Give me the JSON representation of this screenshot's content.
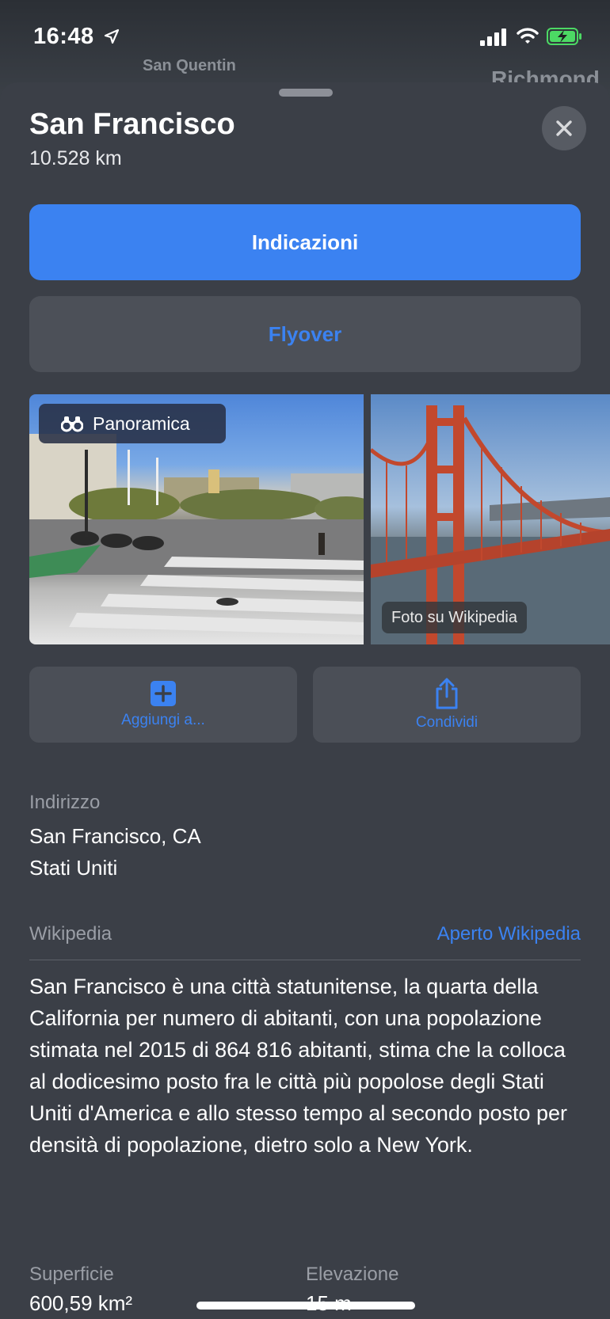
{
  "status_bar": {
    "time": "16:48"
  },
  "map": {
    "labels": [
      "San Quentin",
      "Richmond"
    ]
  },
  "place": {
    "title": "San Francisco",
    "distance": "10.528 km"
  },
  "buttons": {
    "directions": "Indicazioni",
    "flyover": "Flyover"
  },
  "photos": {
    "panorama_label": "Panoramica",
    "wiki_photo_label": "Foto su Wikipedia"
  },
  "actions": {
    "add_label": "Aggiungi a...",
    "share_label": "Condividi"
  },
  "address": {
    "heading": "Indirizzo",
    "line1": "San Francisco, CA",
    "line2": "Stati Uniti"
  },
  "wikipedia": {
    "heading": "Wikipedia",
    "open_link": "Aperto Wikipedia",
    "description": "San Francisco è una città statunitense, la quarta della California per numero di abitanti, con una popolazione stimata nel 2015 di 864 816 abitanti, stima che la colloca al dodicesimo posto fra le città più popolose degli Stati Uniti d'America e allo stesso tempo al secondo posto per densità di popolazione, dietro solo a New York."
  },
  "facts": {
    "area_label": "Superficie",
    "area_value": "600,59 km²",
    "elevation_label": "Elevazione",
    "elevation_value": "15 m"
  },
  "colors": {
    "accent": "#3b82f1",
    "sheet": "#3b3f47",
    "battery": "#4cd964"
  }
}
